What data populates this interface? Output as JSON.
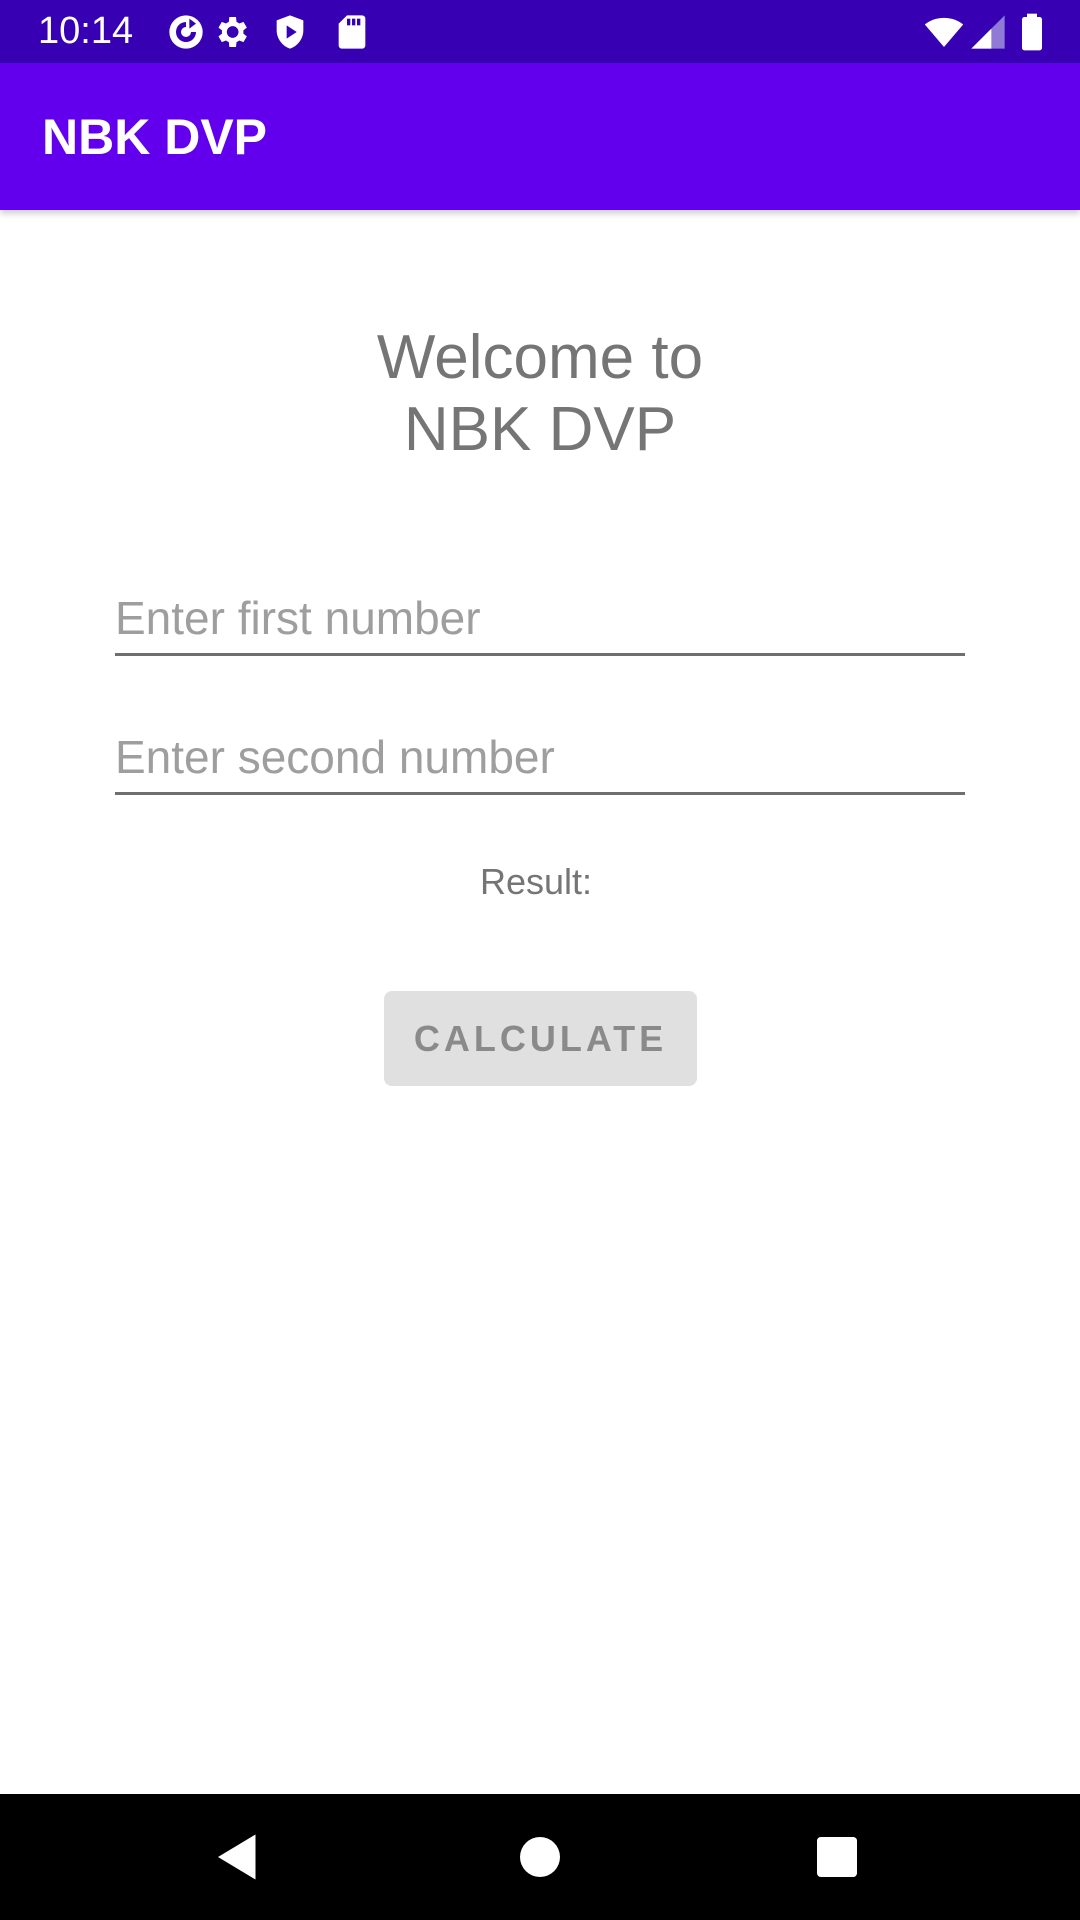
{
  "status_bar": {
    "time": "10:14",
    "icons": [
      "sync-icon",
      "gear-icon",
      "shield-play-icon",
      "sd-card-icon",
      "wifi-icon",
      "signal-icon",
      "battery-icon"
    ]
  },
  "app_bar": {
    "title": "NBK DVP"
  },
  "main": {
    "welcome_line1": "Welcome to",
    "welcome_line2": "NBK DVP",
    "first_number": {
      "value": "",
      "placeholder": "Enter first number"
    },
    "second_number": {
      "value": "",
      "placeholder": "Enter second number"
    },
    "result_label": "Result:",
    "calculate_label": "CALCULATE"
  },
  "nav_bar": {
    "icons": [
      "back-icon",
      "home-icon",
      "recents-icon"
    ]
  },
  "colors": {
    "status_bar": "#3700B3",
    "primary": "#6200EE",
    "button_bg": "#E0E0E0"
  }
}
